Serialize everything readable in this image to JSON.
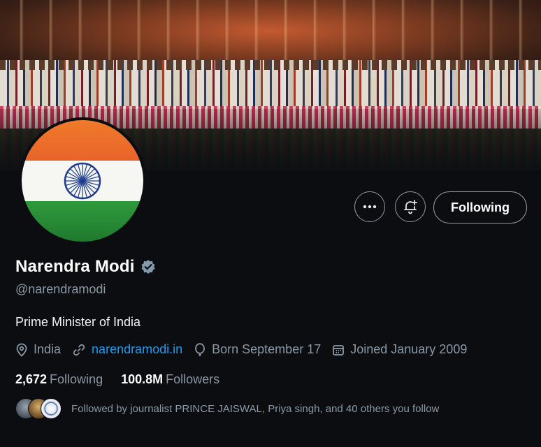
{
  "profile": {
    "name": "Narendra Modi",
    "handle": "@narendramodi",
    "bio": "Prime Minister of India",
    "location": "India",
    "website": "narendramodi.in",
    "birthday": "Born September 17",
    "joined": "Joined January 2009",
    "verified": true
  },
  "actions": {
    "more_icon": "more-horizontal-icon",
    "notify_icon": "bell-plus-icon",
    "follow_label": "Following"
  },
  "stats": {
    "following_count": "2,672",
    "following_label": "Following",
    "followers_count": "100.8M",
    "followers_label": "Followers"
  },
  "followed_by": {
    "text": "Followed by journalist PRINCE JAISWAL, Priya singh, and 40 others you follow"
  },
  "colors": {
    "background": "#0b0d10",
    "link": "#1d9bf0",
    "secondary_text": "#8b98a5",
    "verified_badge": "#829aab",
    "flag_saffron": "#f07a2a",
    "flag_green": "#2f9a3c",
    "chakra": "#1c3b8e"
  }
}
